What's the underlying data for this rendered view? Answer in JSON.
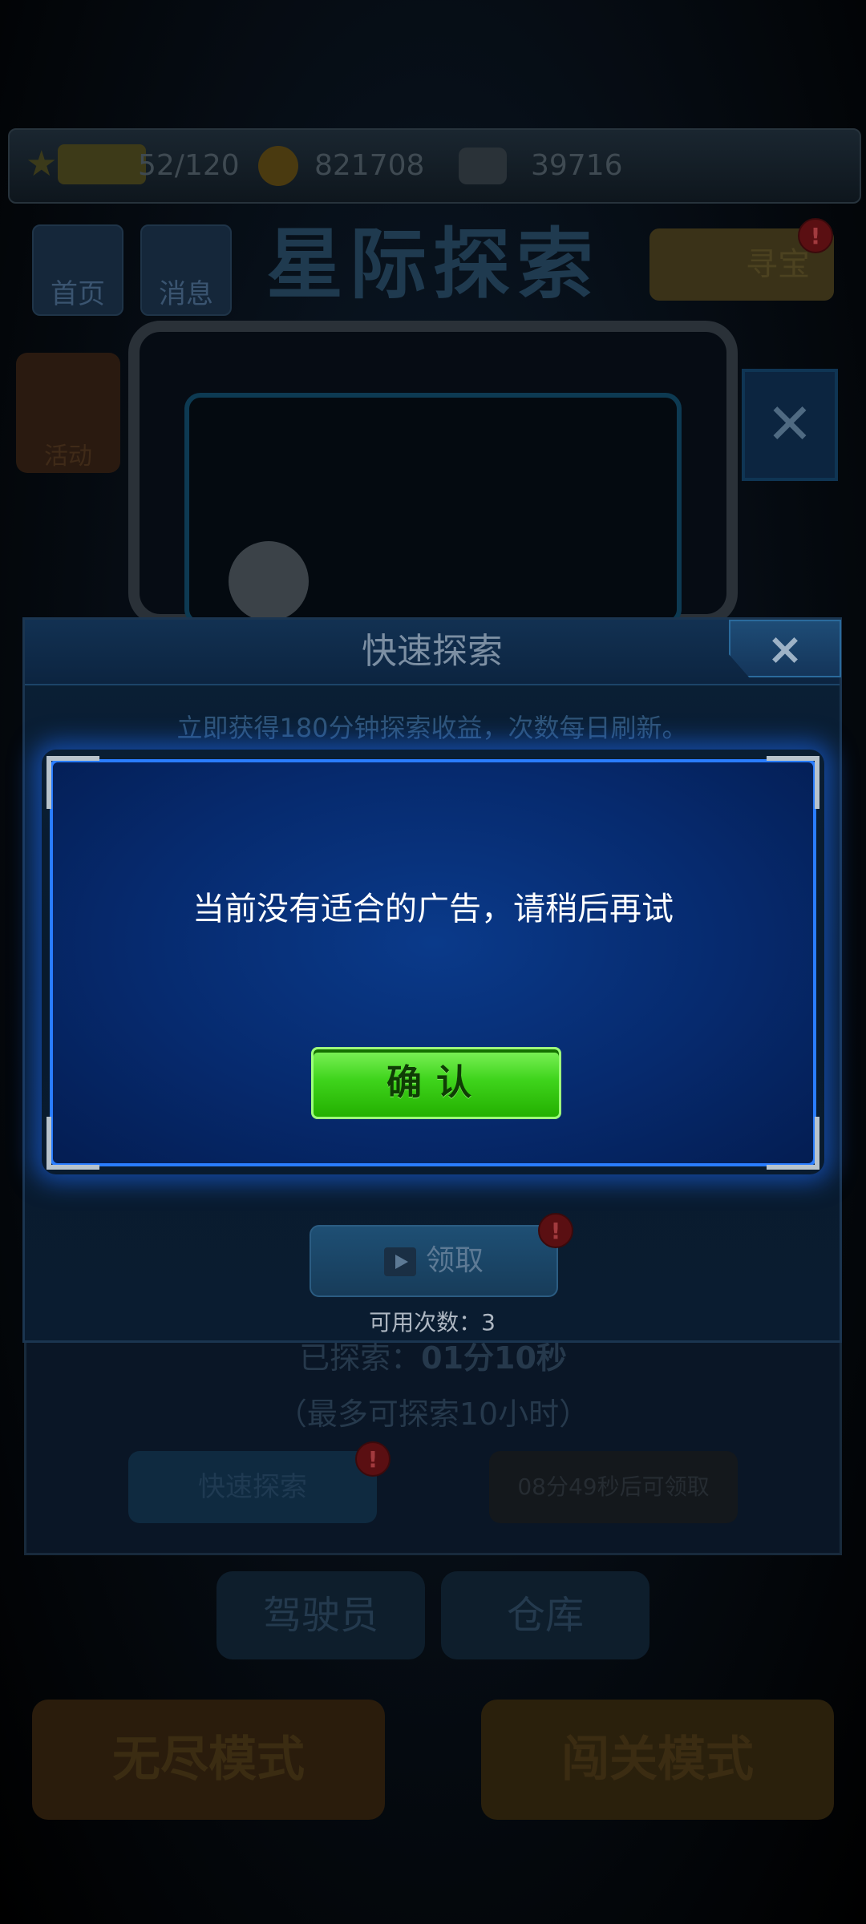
{
  "background": {
    "resources": {
      "stamina": "52/120",
      "coins": "821708",
      "gems": "39716"
    },
    "nav": [
      "首页",
      "消息"
    ],
    "game_title": "星际探索",
    "treasure_label": "寻宝",
    "side_label": "活动",
    "explore_time_label": "已探索：",
    "explore_time_value": "01分10秒",
    "explore_max": "（最多可探索10小时）",
    "quick_explore_btn": "快速探索",
    "claim_timer_btn": "08分49秒后可领取",
    "bottom_tabs": [
      "驾驶员",
      "仓库"
    ],
    "modes": [
      "无尽模式",
      "闯关模式"
    ]
  },
  "panel": {
    "title": "快速探索",
    "close_icon": "×",
    "description": "立即获得180分钟探索收益，次数每日刷新。",
    "claim_label": "领取",
    "badge": "!",
    "count_label": "可用次数：3"
  },
  "dialog": {
    "message": "当前没有适合的广告，请稍后再试",
    "confirm_label": "确认"
  },
  "colors": {
    "accent_blue": "#2a7dff",
    "confirm_green": "#3fd41c",
    "alert_red": "#5a0f12"
  }
}
